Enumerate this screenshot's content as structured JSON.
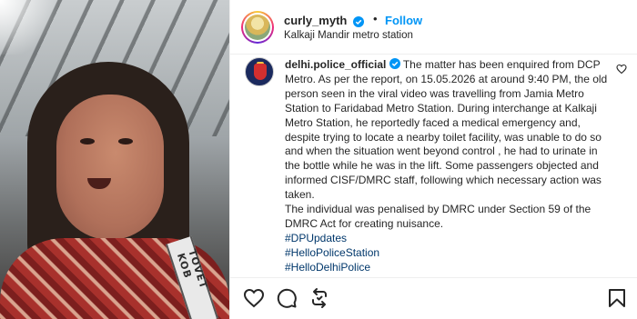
{
  "post": {
    "author": "curly_myth",
    "follow_label": "Follow",
    "separator": "•",
    "location": "Kalkaji Mandir metro station",
    "media_overlay_text": "TOVET KOB"
  },
  "caption": {
    "handle": "delhi.police_official",
    "text_1": "The matter has been enquired from DCP Metro. As per the report, on 15.05.2026 at around 9:40 PM, the old person seen in the viral video was travelling from Jamia Metro Station to Faridabad Metro Station. During interchange at Kalkaji Metro Station, he reportedly faced a medical emergency and, despite trying to locate a nearby toilet facility, was unable to do so and when the situation went beyond control , he had to urinate in the bottle while he was in the lift. Some passengers objected and informed CISF/DMRC staff, following which necessary action was taken.",
    "text_2": "The individual was penalised by DMRC under Section 59 of the DMRC Act for creating nuisance.",
    "hashtags": [
      "#DPUpdates",
      "#HelloPoliceStation",
      "#HelloDelhiPolice"
    ]
  },
  "icons": {
    "verified": "verified-badge-icon",
    "like": "heart-icon",
    "comment": "comment-icon",
    "share": "repost-icon",
    "save": "bookmark-icon",
    "comment_like": "small-heart-icon"
  },
  "colors": {
    "accent": "#0095f6",
    "hashtag": "#00376b",
    "text": "#262626",
    "verified": "#0095f6"
  }
}
